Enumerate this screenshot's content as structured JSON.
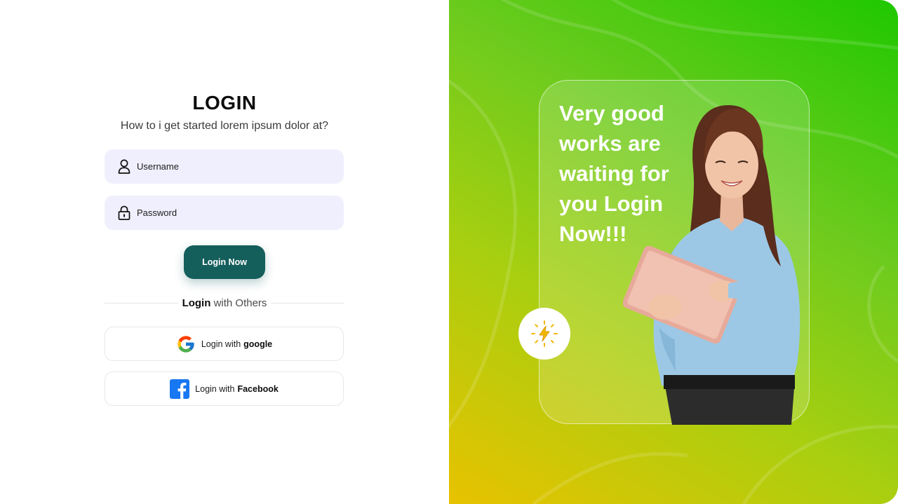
{
  "login": {
    "title": "LOGIN",
    "subtitle": "How to i get started lorem ipsum dolor at?",
    "username_placeholder": "Username",
    "password_placeholder": "Password",
    "login_button": "Login Now",
    "divider_bold": "Login",
    "divider_rest": "with Others",
    "google_prefix": "Login with",
    "google_bold": "google",
    "facebook_prefix": "Login with",
    "facebook_bold": "Facebook"
  },
  "promo": {
    "headline": "Very good works are waiting for you Login Now!!!"
  },
  "icons": {
    "username": "user-icon",
    "password": "lock-icon",
    "google": "google-logo-icon",
    "facebook": "facebook-logo-icon",
    "badge": "lightning-icon"
  },
  "colors": {
    "primary_button": "#145e5c",
    "input_bg": "#f0effd",
    "gradient_start": "#e8c200",
    "gradient_end": "#1fc800"
  }
}
